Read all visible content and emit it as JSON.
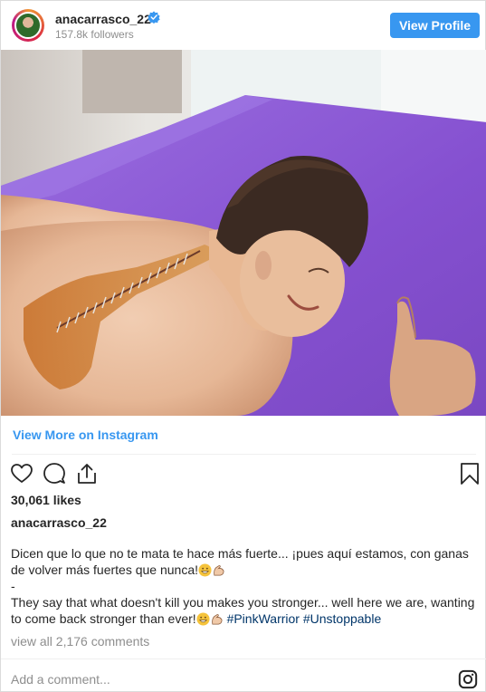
{
  "header": {
    "username": "anacarrasco_22",
    "followers": "157.8k followers",
    "view_profile_label": "View Profile"
  },
  "post": {
    "view_more_label": "View More on Instagram",
    "likes": "30,061 likes",
    "caption_user": "anacarrasco_22",
    "caption_es": "Dicen que lo que no te mata te hace más fuerte... ¡pues aquí estamos, con ganas de volver más fuertes que nunca!",
    "separator": "-",
    "caption_en": "They say that what doesn't kill you makes you stronger... well here we are, wanting to come back stronger than ever!",
    "hashtag_1": "#PinkWarrior",
    "hashtag_2": "#Unstoppable",
    "view_comments": "view all 2,176 comments"
  },
  "comment": {
    "placeholder": "Add a comment..."
  },
  "colors": {
    "accent": "#3897f0",
    "hashtag": "#003569",
    "muted": "#8e8e8e",
    "sheet": "#8a5bd6"
  },
  "icons": [
    "verified-badge-icon",
    "heart-icon",
    "comment-icon",
    "share-icon",
    "bookmark-icon",
    "instagram-icon",
    "grinning-emoji-icon",
    "flexed-biceps-emoji-icon"
  ]
}
